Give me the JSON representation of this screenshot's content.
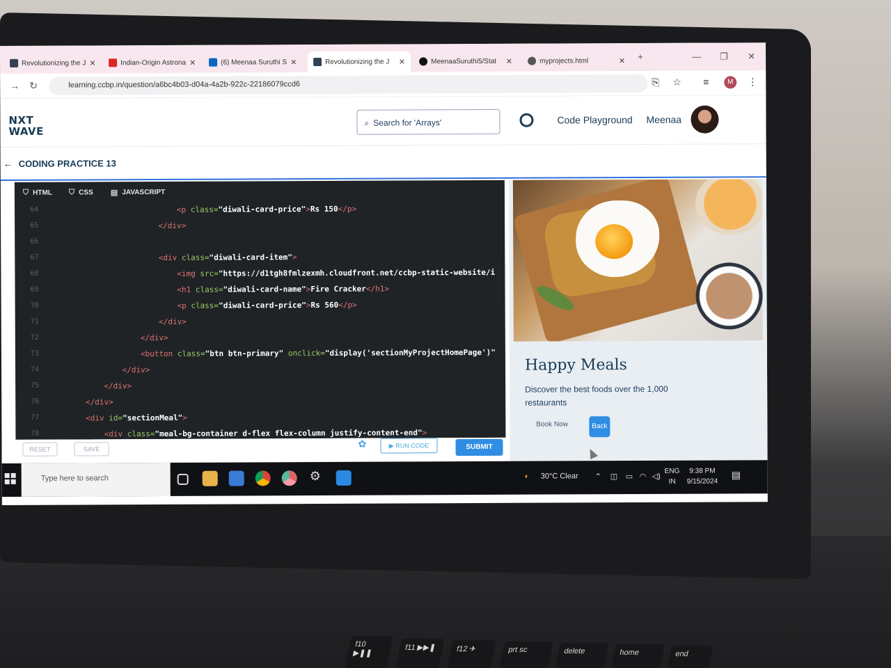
{
  "browser": {
    "tabs": [
      {
        "title": "Revolutionizing the J",
        "favicon_color": "#334155"
      },
      {
        "title": "Indian-Origin Astrona",
        "favicon_color": "#dc2626"
      },
      {
        "title": "(6) Meenaa Suruthi S",
        "favicon_color": "#0a66c2"
      },
      {
        "title": "Revolutionizing the J",
        "favicon_color": "#334155",
        "active": true
      },
      {
        "title": "MeenaaSuruthi5/Stat",
        "favicon_color": "#111111"
      },
      {
        "title": "myprojects.html",
        "favicon_color": "#555555"
      }
    ],
    "close_glyph": "✕",
    "new_tab": "+",
    "url": "learning.ccbp.in/question/a6bc4b03-d04a-4a2b-922c-22186079ccd6",
    "profile_initial": "M"
  },
  "site": {
    "logo_line1": "NXT",
    "logo_line2": "WAVE",
    "search_placeholder": "Search for 'Arrays'",
    "nav_playground": "Code Playground",
    "username": "Meenaa"
  },
  "practice": {
    "title": "CODING PRACTICE 13"
  },
  "editor": {
    "tabs": [
      "HTML",
      "CSS",
      "JAVASCRIPT"
    ],
    "lines": [
      {
        "n": "64",
        "indent": 28,
        "html": [
          [
            "tag",
            "<p "
          ],
          [
            "attr",
            "class="
          ],
          [
            "str",
            "\"diwali-card-price\""
          ],
          [
            "tag",
            ">"
          ],
          [
            "str",
            "Rs 150"
          ],
          [
            "tag",
            "</p>"
          ]
        ]
      },
      {
        "n": "65",
        "indent": 24,
        "html": [
          [
            "tag",
            "</div>"
          ]
        ]
      },
      {
        "n": "66",
        "indent": 0,
        "html": []
      },
      {
        "n": "67",
        "indent": 24,
        "html": [
          [
            "tag",
            "<div "
          ],
          [
            "attr",
            "class="
          ],
          [
            "str",
            "\"diwali-card-item\""
          ],
          [
            "tag",
            ">"
          ]
        ]
      },
      {
        "n": "68",
        "indent": 28,
        "html": [
          [
            "tag",
            "<img "
          ],
          [
            "attr",
            "src="
          ],
          [
            "str",
            "\"https://d1tgh8fmlzexmh.cloudfront.net/ccbp-static-website/i"
          ]
        ]
      },
      {
        "n": "69",
        "indent": 28,
        "html": [
          [
            "tag",
            "<h1 "
          ],
          [
            "attr",
            "class="
          ],
          [
            "str",
            "\"diwali-card-name\""
          ],
          [
            "tag",
            ">"
          ],
          [
            "str",
            "Fire Cracker"
          ],
          [
            "tag",
            "</h1>"
          ]
        ]
      },
      {
        "n": "70",
        "indent": 28,
        "html": [
          [
            "tag",
            "<p "
          ],
          [
            "attr",
            "class="
          ],
          [
            "str",
            "\"diwali-card-price\""
          ],
          [
            "tag",
            ">"
          ],
          [
            "str",
            "Rs 560"
          ],
          [
            "tag",
            "</p>"
          ]
        ]
      },
      {
        "n": "71",
        "indent": 24,
        "html": [
          [
            "tag",
            "</div>"
          ]
        ]
      },
      {
        "n": "72",
        "indent": 20,
        "html": [
          [
            "tag",
            "</div>"
          ]
        ]
      },
      {
        "n": "73",
        "indent": 20,
        "html": [
          [
            "tag",
            "<button "
          ],
          [
            "attr",
            "class="
          ],
          [
            "str",
            "\"btn btn-primary\" "
          ],
          [
            "attr",
            "onclick="
          ],
          [
            "str",
            "\"display('sectionMyProjectHomePage')\""
          ]
        ]
      },
      {
        "n": "74",
        "indent": 16,
        "html": [
          [
            "tag",
            "</div>"
          ]
        ]
      },
      {
        "n": "75",
        "indent": 12,
        "html": [
          [
            "tag",
            "</div>"
          ]
        ]
      },
      {
        "n": "76",
        "indent": 8,
        "html": [
          [
            "tag",
            "</div>"
          ]
        ]
      },
      {
        "n": "77",
        "indent": 8,
        "html": [
          [
            "tag",
            "<div "
          ],
          [
            "attr",
            "id="
          ],
          [
            "str",
            "\"sectionMeal\""
          ],
          [
            "tag",
            ">"
          ]
        ]
      },
      {
        "n": "78",
        "indent": 12,
        "html": [
          [
            "tag",
            "<div "
          ],
          [
            "attr",
            "class="
          ],
          [
            "str",
            "\"meal-bg-container d-flex flex-column justify-content-end\""
          ],
          [
            "tag",
            ">"
          ]
        ]
      }
    ],
    "reset_label": "RESET",
    "save_label": "SAVE",
    "run_label": "▶ RUN CODE",
    "submit_label": "SUBMIT"
  },
  "preview": {
    "title": "Happy Meals",
    "description": "Discover the best foods over the 1,000 restaurants",
    "book_now": "Book Now",
    "back": "Back"
  },
  "taskbar": {
    "search_placeholder": "Type here to search",
    "weather": "30°C  Clear",
    "lang1": "ENG",
    "lang2": "IN",
    "time": "9:38 PM",
    "date": "9/15/2024",
    "icons": [
      "task-view-icon",
      "file-explorer-icon",
      "store-icon",
      "chrome-icon",
      "chrome-profile-icon",
      "settings-icon",
      "vscode-icon"
    ]
  },
  "keyboard": {
    "keys": [
      "f10",
      "f11",
      "f12",
      "prt sc",
      "delete",
      "home",
      "end"
    ]
  }
}
